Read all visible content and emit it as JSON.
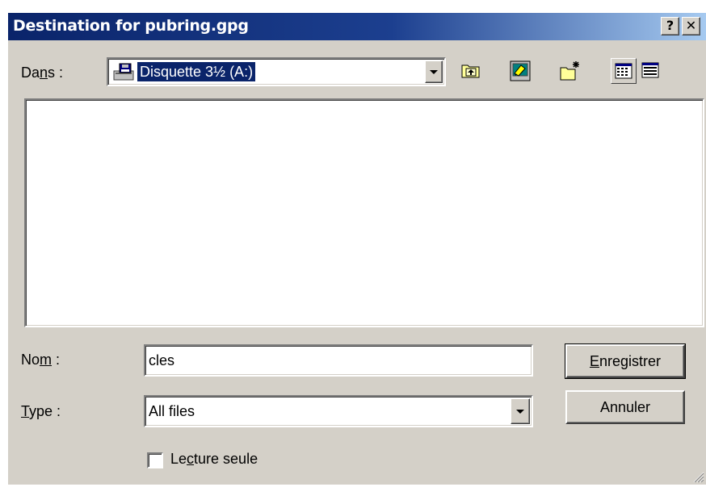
{
  "window": {
    "title": "Destination for pubring.gpg",
    "help_label": "?",
    "close_label": "✕"
  },
  "location": {
    "label_prefix": "Da",
    "label_accel": "n",
    "label_suffix": "s :",
    "selected": "Disquette 3½ (A:)",
    "icon": "floppy-drive-icon"
  },
  "toolbar": {
    "buttons": [
      {
        "name": "up-one-level",
        "icon": "folder-up-icon"
      },
      {
        "name": "desktop",
        "icon": "desktop-icon"
      },
      {
        "name": "new-folder",
        "icon": "new-folder-icon"
      },
      {
        "name": "list-view",
        "icon": "list-view-icon"
      },
      {
        "name": "details-view",
        "icon": "details-view-icon"
      }
    ]
  },
  "filename": {
    "label_prefix": "No",
    "label_accel": "m",
    "label_suffix": " :",
    "value": "cles"
  },
  "filetype": {
    "label_accel": "T",
    "label_suffix": "ype :",
    "selected": "All files"
  },
  "readonly": {
    "label_prefix": "Le",
    "label_accel": "c",
    "label_suffix": "ture seule",
    "checked": false
  },
  "buttons": {
    "save_accel": "E",
    "save_rest": "nregistrer",
    "cancel": "Annuler"
  },
  "colors": {
    "title_gradient_start": "#0a246a",
    "title_gradient_end": "#a6caf0",
    "face": "#d4d0c8",
    "selection": "#0a246a"
  }
}
